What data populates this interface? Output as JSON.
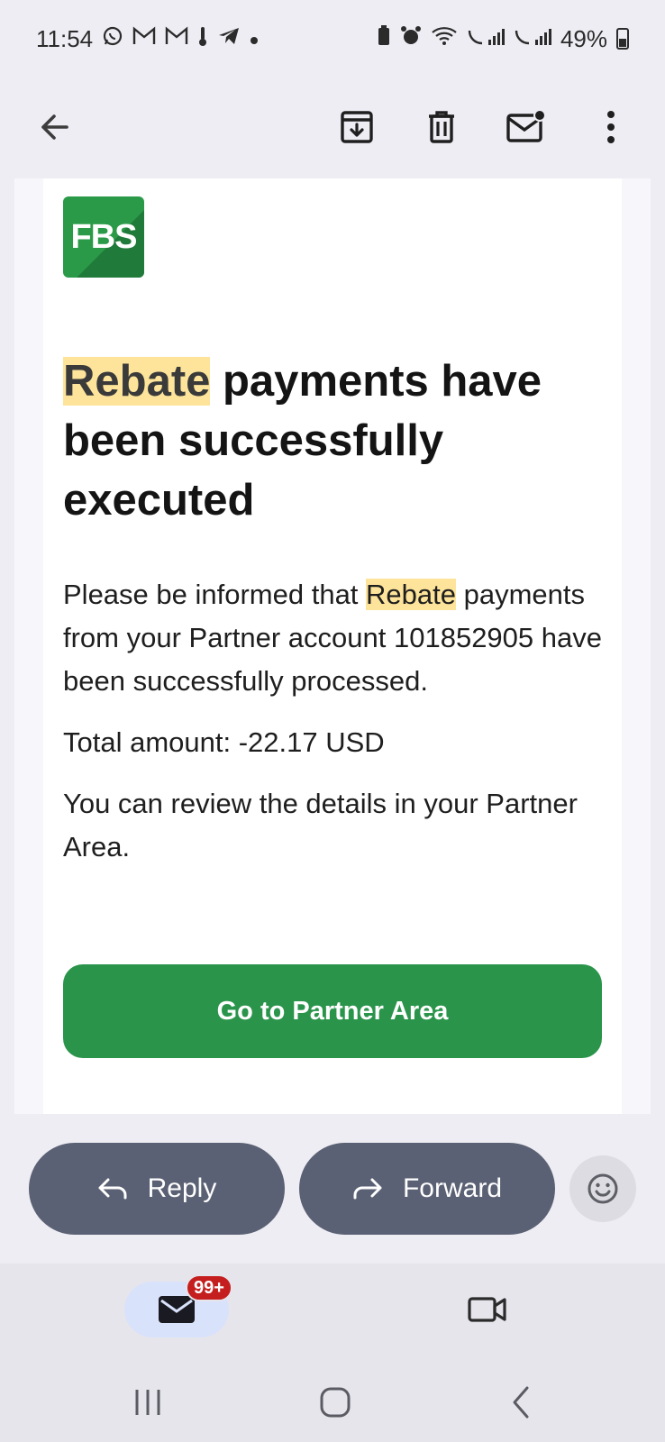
{
  "status_bar": {
    "time": "11:54",
    "left_icons": [
      "whatsapp-icon",
      "gmail-icon",
      "gmail-icon",
      "thermometer-icon",
      "telegram-icon",
      "dot-icon"
    ],
    "right_icons": [
      "battery-saver-icon",
      "alarm-icon",
      "wifi-icon",
      "sim1-signal-icon",
      "sim2-signal-icon"
    ],
    "battery_percent": "49%"
  },
  "app_bar": {
    "icons": [
      "back-arrow-icon",
      "archive-icon",
      "delete-icon",
      "mark-unread-icon",
      "more-vert-icon"
    ]
  },
  "email": {
    "logo_text": "FBS",
    "headline_highlight": "Rebate",
    "headline_rest": " payments have been successfully executed",
    "para1_prefix": "Please be informed that ",
    "para1_highlight": "Rebate",
    "para1_suffix": " payments from your Partner account 101852905 have been successfully processed.",
    "total": "Total amount: -22.17 USD",
    "review": "You can review the details in your Partner Area.",
    "cta_label": "Go to Partner Area"
  },
  "actions": {
    "reply_label": "Reply",
    "forward_label": "Forward"
  },
  "bottom_nav": {
    "mail_badge": "99+"
  },
  "colors": {
    "brand_green": "#2a944b",
    "highlight": "#fde49a",
    "pill": "#5b6174",
    "badge_red": "#c41e1e"
  }
}
